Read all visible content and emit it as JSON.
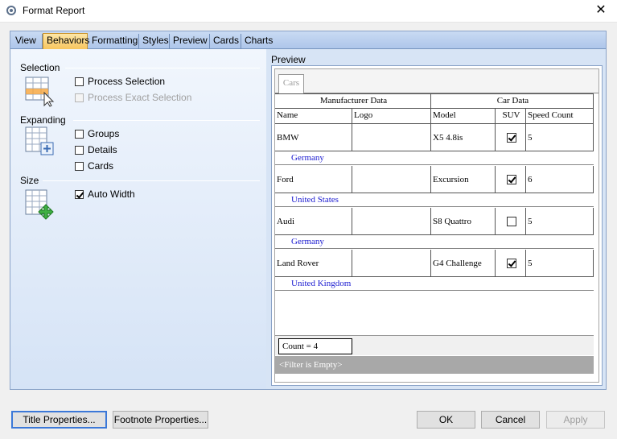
{
  "window": {
    "title": "Format Report",
    "close_glyph": "✕"
  },
  "tabs": [
    "View",
    "Behaviors",
    "Formatting",
    "Styles",
    "Preview",
    "Cards",
    "Charts"
  ],
  "active_tab": "Behaviors",
  "behaviors": {
    "selection": {
      "label": "Selection",
      "process_selection": {
        "label": "Process Selection",
        "checked": false,
        "enabled": true
      },
      "process_exact_selection": {
        "label": "Process Exact Selection",
        "checked": false,
        "enabled": false
      }
    },
    "expanding": {
      "label": "Expanding",
      "groups": {
        "label": "Groups",
        "checked": false
      },
      "details": {
        "label": "Details",
        "checked": false
      },
      "cards": {
        "label": "Cards",
        "checked": false
      }
    },
    "size": {
      "label": "Size",
      "auto_width": {
        "label": "Auto Width",
        "checked": true
      }
    }
  },
  "preview": {
    "label": "Preview",
    "tab": "Cars",
    "bands": [
      "Manufacturer Data",
      "Car Data"
    ],
    "columns": [
      "Name",
      "Logo",
      "Model",
      "SUV",
      "Speed Count"
    ],
    "rows": [
      {
        "name": "BMW",
        "logo": "",
        "model": "X5 4.8is",
        "suv": true,
        "speed_count": "5",
        "country": "Germany"
      },
      {
        "name": "Ford",
        "logo": "",
        "model": "Excursion",
        "suv": true,
        "speed_count": "6",
        "country": "United States"
      },
      {
        "name": "Audi",
        "logo": "",
        "model": "S8 Quattro",
        "suv": false,
        "speed_count": "5",
        "country": "Germany"
      },
      {
        "name": "Land Rover",
        "logo": "",
        "model": "G4 Challenge",
        "suv": true,
        "speed_count": "5",
        "country": "United Kingdom"
      }
    ],
    "count": "Count = 4",
    "filter": "<Filter is Empty>"
  },
  "buttons": {
    "title_properties": "Title Properties...",
    "footnote_properties": "Footnote Properties...",
    "ok": "OK",
    "cancel": "Cancel",
    "apply": "Apply"
  },
  "colors": {
    "accent": "#3b78d8",
    "tab_active": "#f7c35a",
    "group_text": "#1a1ad0",
    "filter_bar": "#a8a8a8"
  }
}
